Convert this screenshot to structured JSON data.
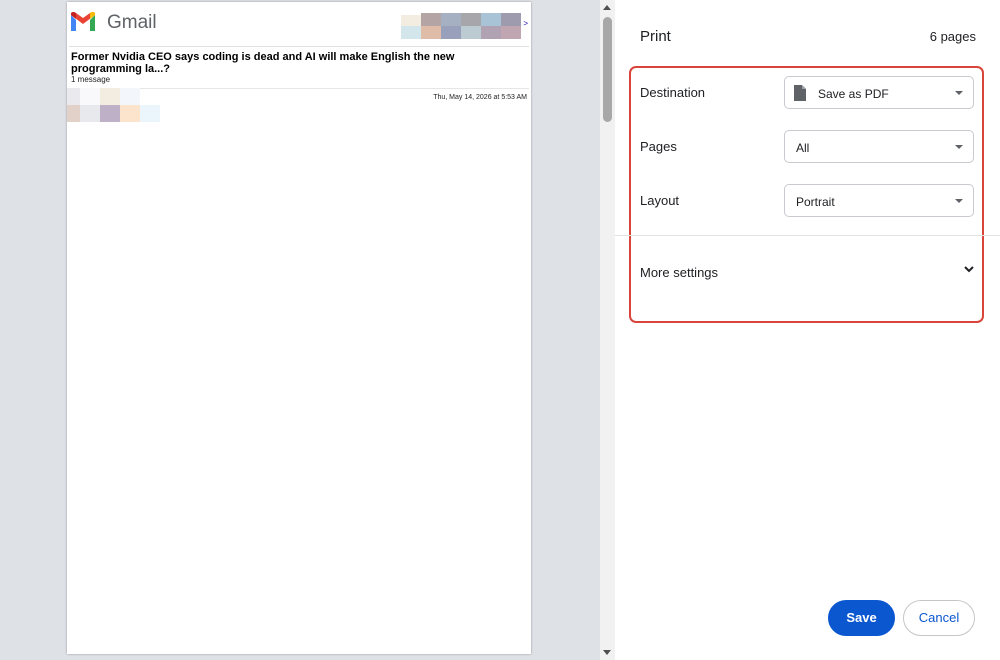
{
  "preview": {
    "app_name": "Gmail",
    "subject": "Former Nvidia CEO says coding is dead and AI will make English the new programming la...?",
    "message_count": "1 message",
    "date": "Thu, May 14, 2026 at 5:53 AM",
    "arrow": ">"
  },
  "print": {
    "title": "Print",
    "page_count": "6 pages",
    "destination": {
      "label": "Destination",
      "value": "Save as PDF",
      "icon": "document-icon"
    },
    "pages": {
      "label": "Pages",
      "value": "All"
    },
    "layout": {
      "label": "Layout",
      "value": "Portrait"
    },
    "more_settings": "More settings",
    "save_label": "Save",
    "cancel_label": "Cancel"
  },
  "colors": {
    "accent": "#0b57d0",
    "highlight_border": "#d9453a",
    "preview_background": "#dee1e6"
  }
}
